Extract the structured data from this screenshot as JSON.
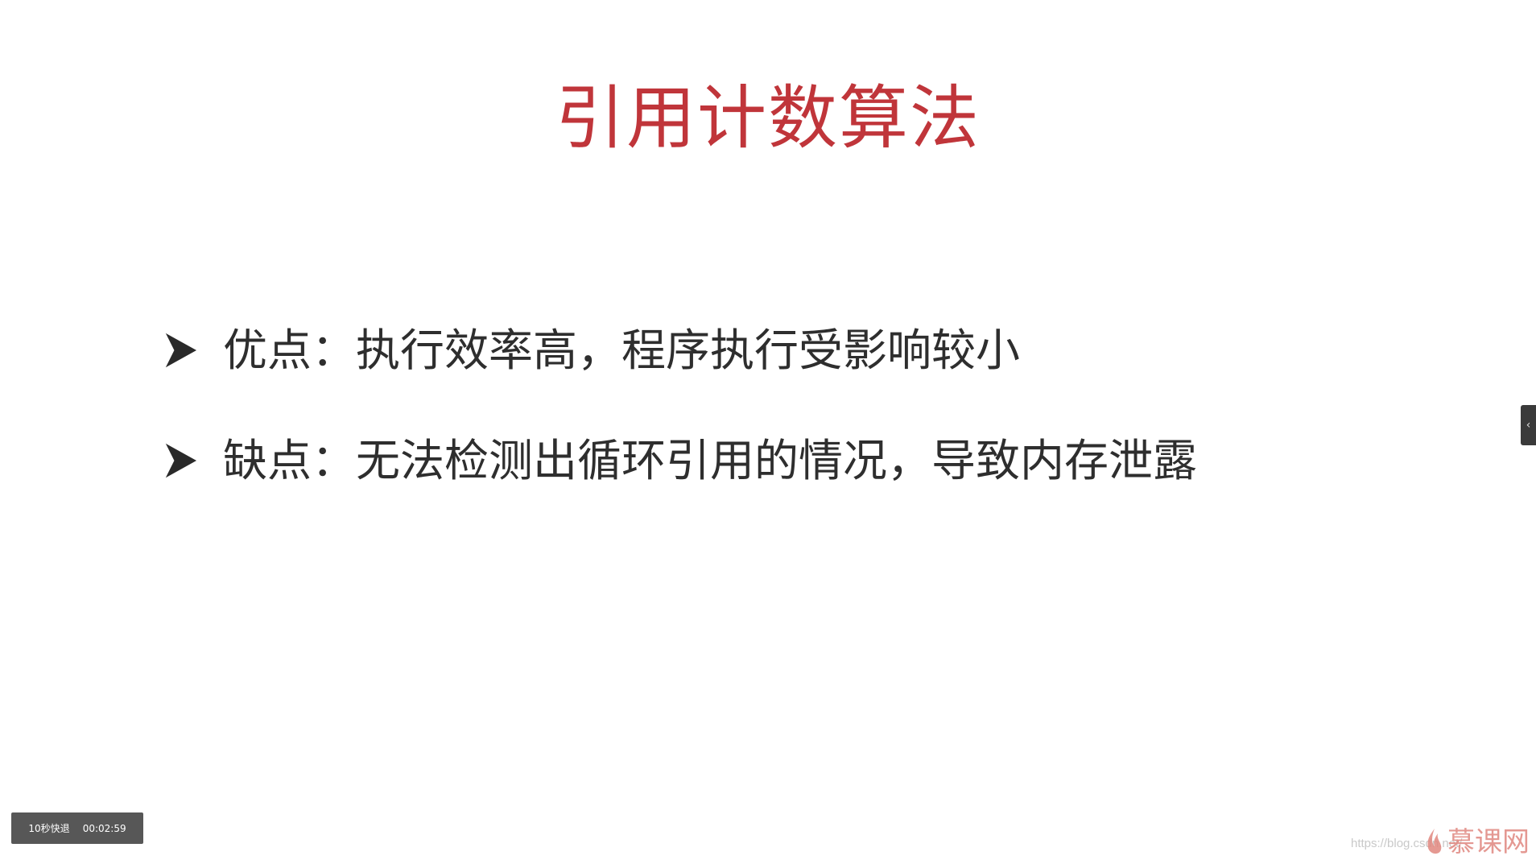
{
  "slide": {
    "title": "引用计数算法",
    "title_color": "#c0353a",
    "bullets": [
      {
        "icon": "arrowhead-bullet-icon",
        "text": "优点：执行效率高，程序执行受影响较小"
      },
      {
        "icon": "arrowhead-bullet-icon",
        "text": "缺点：无法检测出循环引用的情况，导致内存泄露"
      }
    ]
  },
  "player": {
    "rewind_label": "10秒快退",
    "timestamp": "00:02:59"
  },
  "side_panel": {
    "toggle_icon": "chevron-left-icon",
    "toggle_glyph": "‹"
  },
  "watermark": {
    "text": "https://blog.csdn.net/"
  },
  "brand": {
    "logo_icon": "flame-icon",
    "name": "慕课网",
    "color": "#e0877f"
  }
}
